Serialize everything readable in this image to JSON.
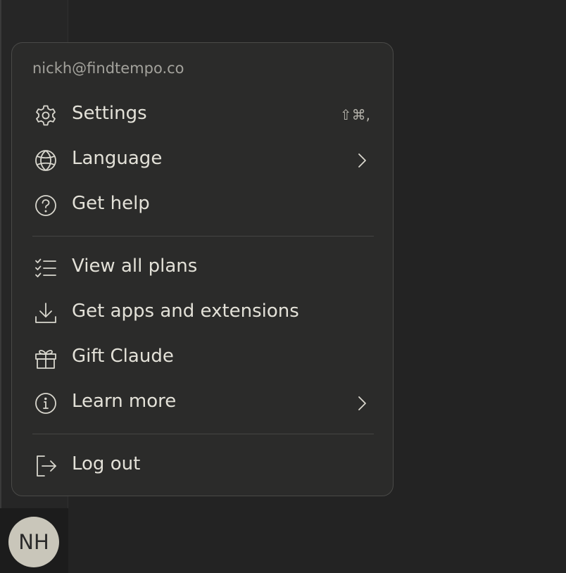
{
  "user": {
    "email": "nickh@findtempo.co",
    "initials": "NH"
  },
  "menu": {
    "settings": {
      "label": "Settings",
      "shortcut": "⇧⌘,",
      "icon": "gear-icon"
    },
    "language": {
      "label": "Language",
      "icon": "globe-icon"
    },
    "help": {
      "label": "Get help",
      "icon": "question-circle-icon"
    },
    "plans": {
      "label": "View all plans",
      "icon": "checklist-icon"
    },
    "apps": {
      "label": "Get apps and extensions",
      "icon": "download-icon"
    },
    "gift": {
      "label": "Gift Claude",
      "icon": "gift-icon"
    },
    "learn": {
      "label": "Learn more",
      "icon": "info-circle-icon"
    },
    "logout": {
      "label": "Log out",
      "icon": "logout-icon"
    }
  },
  "colors": {
    "background": "#232323",
    "menu_background": "#2b2b2a",
    "text": "#e3e1d8",
    "muted_text": "#a3a29c",
    "avatar": "#c9c6ba"
  }
}
